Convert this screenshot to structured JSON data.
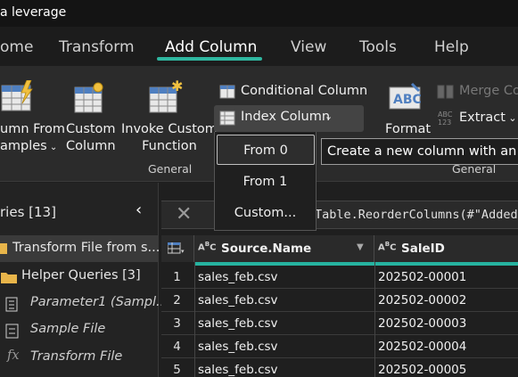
{
  "window": {
    "title": "a leverage"
  },
  "tabs": [
    {
      "label": "ome"
    },
    {
      "label": "Transform"
    },
    {
      "label": "Add Column"
    },
    {
      "label": "View"
    },
    {
      "label": "Tools"
    },
    {
      "label": "Help"
    }
  ],
  "ribbon": {
    "column_from_examples": {
      "line1": "umn From",
      "line2": "amples"
    },
    "custom_column": {
      "line1": "Custom",
      "line2": "Column"
    },
    "invoke_custom_function": {
      "line1": "Invoke Custom",
      "line2": "Function"
    },
    "conditional_column": "Conditional Column",
    "index_column": "Index Column",
    "format": "Format",
    "merge_columns": "Merge Co",
    "extract": "Extract",
    "group_general_1": "General",
    "group_general_2": "General"
  },
  "index_dropdown": {
    "items": [
      "From 0",
      "From 1",
      "Custom..."
    ],
    "tooltip": "Create a new column with an index"
  },
  "queries": {
    "header": "ries [13]",
    "items": [
      {
        "label": "Transform File from s..."
      },
      {
        "label": "Helper Queries [3]"
      },
      {
        "label": "Parameter1 (Sampl..."
      },
      {
        "label": "Sample File"
      },
      {
        "label": "Transform File"
      }
    ]
  },
  "formula": {
    "text": "Table.ReorderColumns(#\"Added"
  },
  "table": {
    "columns": [
      {
        "name": "Source.Name",
        "type_icon": "ABC"
      },
      {
        "name": "SaleID",
        "type_icon": "ABC"
      }
    ],
    "rows": [
      {
        "num": "1",
        "source": "sales_feb.csv",
        "saleid": "202502-00001"
      },
      {
        "num": "2",
        "source": "sales_feb.csv",
        "saleid": "202502-00002"
      },
      {
        "num": "3",
        "source": "sales_feb.csv",
        "saleid": "202502-00003"
      },
      {
        "num": "4",
        "source": "sales_feb.csv",
        "saleid": "202502-00004"
      },
      {
        "num": "5",
        "source": "sales_feb.csv",
        "saleid": "202502-00005"
      }
    ]
  },
  "colors": {
    "accent": "#2fb7a0",
    "background": "#1f1f1f",
    "ribbon": "#2b2b2b"
  }
}
